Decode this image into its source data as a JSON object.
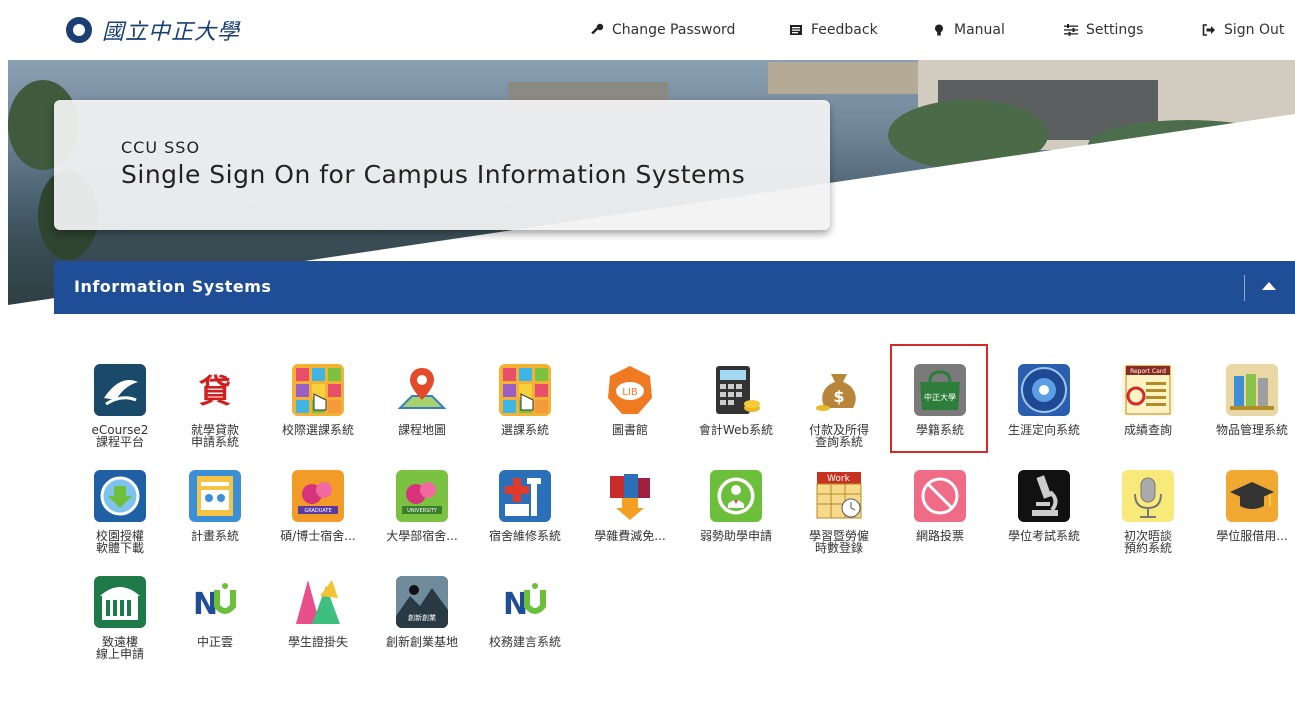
{
  "header": {
    "logo_text": "國立中正大學",
    "nav": [
      {
        "label": "Change Password",
        "icon": "key-icon"
      },
      {
        "label": "Feedback",
        "icon": "feedback-icon"
      },
      {
        "label": "Manual",
        "icon": "lightbulb-icon"
      },
      {
        "label": "Settings",
        "icon": "settings-sliders-icon"
      },
      {
        "label": "Sign Out",
        "icon": "sign-out-icon"
      }
    ]
  },
  "hero": {
    "subtitle": "CCU SSO",
    "title": "Single Sign On for Campus Information Systems"
  },
  "panel": {
    "title": "Information Systems",
    "header_color": "#1f4e96"
  },
  "apps": [
    {
      "label": "eCourse2\n課程平台",
      "icon": "ecourse-icon"
    },
    {
      "label": "就學貸款\n申請系統",
      "icon": "loan-icon"
    },
    {
      "label": "校際選課系統",
      "icon": "course-grid-icon"
    },
    {
      "label": "課程地圖",
      "icon": "map-pin-icon"
    },
    {
      "label": "選課系統",
      "icon": "course-grid-icon"
    },
    {
      "label": "圖書館",
      "icon": "library-icon"
    },
    {
      "label": "會計Web系統",
      "icon": "calculator-icon"
    },
    {
      "label": "付款及所得\n查詢系統",
      "icon": "money-bag-icon"
    },
    {
      "label": "學籍系統",
      "icon": "student-record-bag-icon"
    },
    {
      "label": "生涯定向系統",
      "icon": "career-emblem-icon"
    },
    {
      "label": "成績查詢",
      "icon": "report-card-icon"
    },
    {
      "label": "物品管理系統",
      "icon": "binders-icon"
    },
    {
      "label": "校園授權\n軟體下載",
      "icon": "download-icon"
    },
    {
      "label": "計畫系統",
      "icon": "plan-icon"
    },
    {
      "label": "碩/博士宿舍...",
      "icon": "graduate-dorm-icon"
    },
    {
      "label": "大學部宿舍...",
      "icon": "university-dorm-icon"
    },
    {
      "label": "宿舍維修系統",
      "icon": "repair-icon"
    },
    {
      "label": "學雜費減免...",
      "icon": "fee-reduction-icon"
    },
    {
      "label": "弱勢助學申請",
      "icon": "assistance-icon"
    },
    {
      "label": "學習暨勞僱\n時數登錄",
      "icon": "work-hours-icon"
    },
    {
      "label": "網路投票",
      "icon": "vote-icon"
    },
    {
      "label": "學位考試系統",
      "icon": "microscope-icon"
    },
    {
      "label": "初次晤談\n預約系統",
      "icon": "microphone-icon"
    },
    {
      "label": "學位服借用...",
      "icon": "graduation-cap-icon"
    },
    {
      "label": "致遠樓\n線上申請",
      "icon": "building-icon"
    },
    {
      "label": "中正雲",
      "icon": "nu-cloud-icon"
    },
    {
      "label": "學生證掛失",
      "icon": "student-card-icon"
    },
    {
      "label": "創新創業基地",
      "icon": "innovation-icon"
    },
    {
      "label": "校務建言系統",
      "icon": "nu-suggestion-icon"
    }
  ],
  "selected_app": "學籍系統",
  "highlight_color": "#d42a2a"
}
